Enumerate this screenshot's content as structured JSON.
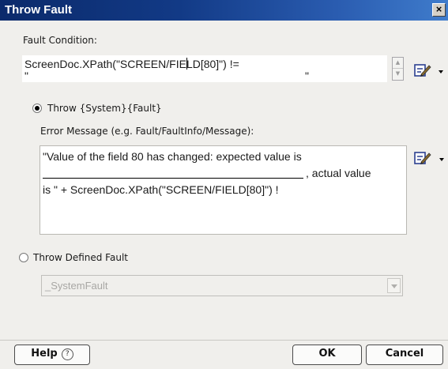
{
  "window": {
    "title": "Throw Fault",
    "close_glyph": "×"
  },
  "fault_condition": {
    "label": "Fault Condition:",
    "value_before_caret": "ScreenDoc.XPath(\"SCREEN/FIE",
    "value_after_caret": "LD[80]\") !=",
    "second_line_left": "\"",
    "second_line_right": "\""
  },
  "throw_system": {
    "label": "Throw {System}{Fault}",
    "selected": true,
    "error_message_label": "Error Message (e.g. Fault/FaultInfo/Message):",
    "message_lines": [
      "\"Value of the field 80 has changed: expected value is",
      ", actual value",
      "is \" + ScreenDoc.XPath(\"SCREEN/FIELD[80]\") !"
    ]
  },
  "throw_defined": {
    "label": "Throw Defined Fault",
    "selected": false,
    "selected_value": "_SystemFault"
  },
  "buttons": {
    "help": "Help",
    "help_glyph": "?",
    "ok": "OK",
    "cancel": "Cancel"
  },
  "icons": {
    "edit": "edit-expression-icon",
    "dropdown": "chevron-down-icon",
    "spin": "spin-arrows-icon"
  }
}
